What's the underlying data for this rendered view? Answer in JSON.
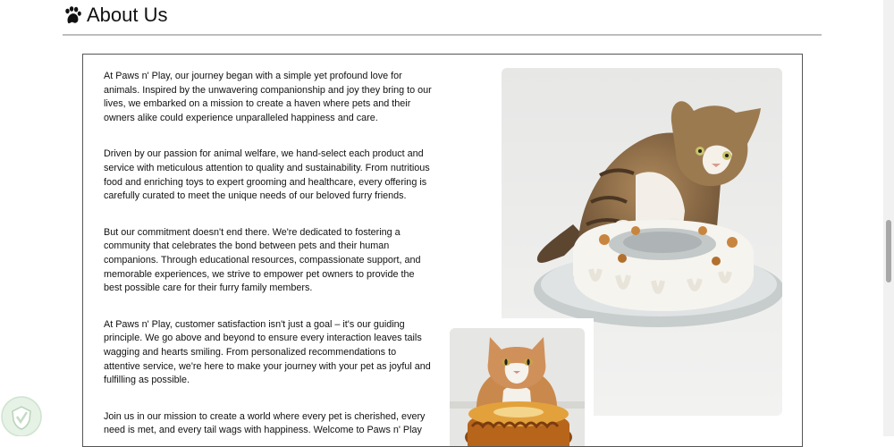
{
  "header": {
    "icon": "paw-icon",
    "title": "About Us"
  },
  "about": {
    "paragraphs": [
      "At Paws n' Play, our journey began with a simple yet profound love for animals. Inspired by the unwavering companionship and joy they bring to our lives, we embarked on a mission to create a haven where pets and their owners alike could experience unparalleled happiness and care.",
      "Driven by our passion for animal welfare, we hand-select each product and service with meticulous attention to quality and sustainability. From nutritious food and enriching toys to expert grooming and healthcare, every offering is carefully curated to meet the unique needs of our beloved furry friends.",
      "But our commitment doesn't end there. We're dedicated to fostering a community that celebrates the bond between pets and their human companions. Through educational resources, compassionate support, and memorable experiences, we strive to empower pet owners to provide the best possible care for their furry family members.",
      "At Paws n' Play, customer satisfaction isn't just a goal – it's our guiding principle. We go above and beyond to ensure every interaction leaves tails wagging and hearts smiling. From personalized recommendations to attentive service, we're here to make your journey with your pet as joyful and fulfilling as possible.",
      "Join us in our mission to create a world where every pet is cherished, every need is met, and every tail wags with happiness. Welcome to Paws n' Play"
    ]
  },
  "images": {
    "big": "tabby-cat-with-iced-bundt-cake-photo",
    "small": "orange-cat-with-cake-photo"
  },
  "colors": {
    "text": "#111111",
    "rule": "#bdbdbd",
    "panel_border": "#555555"
  }
}
